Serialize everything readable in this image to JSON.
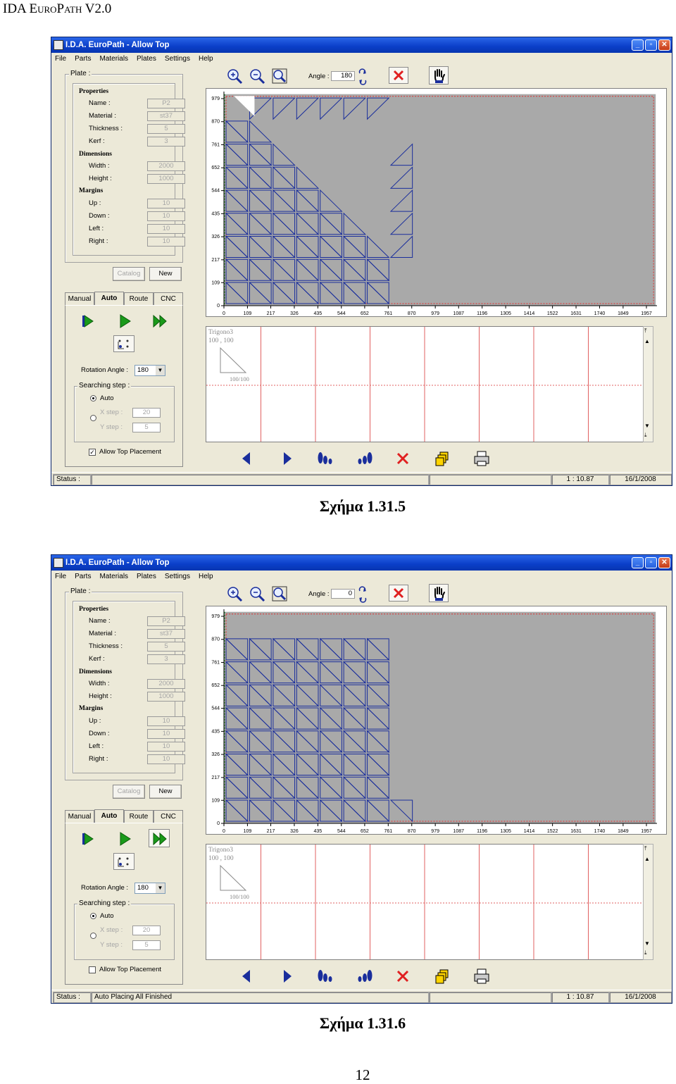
{
  "document": {
    "header": "IDA EuroPath V2.0",
    "page_number": "12"
  },
  "screens": [
    {
      "caption": "Σχήμα 1.31.5",
      "window_title": "I.D.A. EuroPath - Allow Top",
      "menu": [
        "File",
        "Parts",
        "Materials",
        "Plates",
        "Settings",
        "Help"
      ],
      "angle_label": "Angle :",
      "angle_value": "180",
      "plate": {
        "group_label": "Plate :",
        "properties_heading": "Properties",
        "name_label": "Name :",
        "name_value": "P2",
        "material_label": "Material :",
        "material_value": "st37",
        "thickness_label": "Thickness :",
        "thickness_value": "5",
        "kerf_label": "Kerf :",
        "kerf_value": "3",
        "dimensions_heading": "Dimensions",
        "width_label": "Width :",
        "width_value": "2000",
        "height_label": "Height :",
        "height_value": "1000",
        "margins_heading": "Margins",
        "up_label": "Up :",
        "up_value": "10",
        "down_label": "Down :",
        "down_value": "10",
        "left_label": "Left :",
        "left_value": "10",
        "right_label": "Right :",
        "right_value": "10"
      },
      "catalog_button": "Catalog",
      "new_button": "New",
      "tabs": [
        "Manual",
        "Auto",
        "Route",
        "CNC"
      ],
      "rotation_label": "Rotation Angle :",
      "rotation_value": "180",
      "searching_label": "Searching step :",
      "auto_label": "Auto",
      "xstep_label": "X step :",
      "xstep_value": "20",
      "ystep_label": "Y step :",
      "ystep_value": "5",
      "allow_top_label": "Allow Top Placement",
      "allow_top_checked": true,
      "x_ticks": [
        "0",
        "109",
        "217",
        "326",
        "435",
        "544",
        "652",
        "761",
        "870",
        "979",
        "1087",
        "1196",
        "1305",
        "1414",
        "1522",
        "1631",
        "1740",
        "1849",
        "1957"
      ],
      "y_ticks": [
        "979",
        "870",
        "761",
        "652",
        "544",
        "435",
        "326",
        "217",
        "109",
        "0"
      ],
      "part_name": "Trigono3",
      "part_dims": "100 , 100",
      "part_thumb_label": "100/100",
      "status_label": "Status :",
      "status_text": "",
      "scale": "1 : 10.87",
      "date": "16/1/2008"
    },
    {
      "caption": "Σχήμα 1.31.6",
      "window_title": "I.D.A. EuroPath - Allow Top",
      "menu": [
        "File",
        "Parts",
        "Materials",
        "Plates",
        "Settings",
        "Help"
      ],
      "angle_label": "Angle :",
      "angle_value": "0",
      "plate": {
        "group_label": "Plate :",
        "properties_heading": "Properties",
        "name_label": "Name :",
        "name_value": "P2",
        "material_label": "Material :",
        "material_value": "st37",
        "thickness_label": "Thickness :",
        "thickness_value": "5",
        "kerf_label": "Kerf :",
        "kerf_value": "3",
        "dimensions_heading": "Dimensions",
        "width_label": "Width :",
        "width_value": "2000",
        "height_label": "Height :",
        "height_value": "1000",
        "margins_heading": "Margins",
        "up_label": "Up :",
        "up_value": "10",
        "down_label": "Down :",
        "down_value": "10",
        "left_label": "Left :",
        "left_value": "10",
        "right_label": "Right :",
        "right_value": "10"
      },
      "catalog_button": "Catalog",
      "new_button": "New",
      "tabs": [
        "Manual",
        "Auto",
        "Route",
        "CNC"
      ],
      "rotation_label": "Rotation Angle :",
      "rotation_value": "180",
      "searching_label": "Searching step :",
      "auto_label": "Auto",
      "xstep_label": "X step :",
      "xstep_value": "20",
      "ystep_label": "Y step :",
      "ystep_value": "5",
      "allow_top_label": "Allow Top Placement",
      "allow_top_checked": false,
      "x_ticks": [
        "0",
        "109",
        "217",
        "326",
        "435",
        "544",
        "652",
        "761",
        "870",
        "979",
        "1087",
        "1196",
        "1305",
        "1414",
        "1522",
        "1631",
        "1740",
        "1849",
        "1957"
      ],
      "y_ticks": [
        "979",
        "870",
        "761",
        "652",
        "544",
        "435",
        "326",
        "217",
        "109",
        "0"
      ],
      "part_name": "Trigono3",
      "part_dims": "100 , 100",
      "part_thumb_label": "100/100",
      "status_label": "Status :",
      "status_text": "Auto Placing All Finished",
      "scale": "1 : 10.87",
      "date": "16/1/2008"
    }
  ],
  "icons": [
    "zoom-in-icon",
    "zoom-out-icon",
    "zoom-fit-icon",
    "rotate-cw-icon",
    "rotate-ccw-icon",
    "delete-icon",
    "hand-icon",
    "step-icon",
    "play-icon",
    "fast-forward-icon",
    "grid-search-icon",
    "prev-icon",
    "next-icon",
    "place-left-icon",
    "place-right-icon",
    "copy-icon",
    "print-icon"
  ],
  "colors": {
    "part_outline": "#1a2e9c",
    "sheet_fill": "#a9a9a9",
    "margin_line": "#e03030",
    "title_blue": "#0a3ec8"
  }
}
